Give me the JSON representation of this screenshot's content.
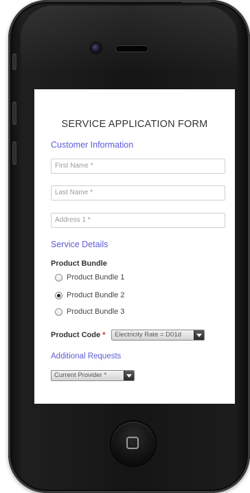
{
  "form": {
    "title": "SERVICE APPLICATION FORM",
    "sections": {
      "customer_information": "Customer Information",
      "service_details": "Service Details",
      "additional_requests": "Additional Requests"
    },
    "fields": {
      "first_name": "First Name *",
      "last_name": "Last Name *",
      "address1": "Address 1 *"
    },
    "product_bundle": {
      "label": "Product Bundle",
      "options": [
        "Product Bundle 1",
        "Product Bundle 2",
        "Product Bundle 3"
      ],
      "selected": "Product Bundle 2"
    },
    "product_code": {
      "label": "Product Code",
      "required_mark": "*",
      "value": "Electricity Rate = D01d"
    },
    "current_provider": {
      "value": "Current Provider *"
    }
  },
  "icons": {
    "home": "home-square-icon",
    "dropdown": "chevron-down-icon",
    "camera": "camera-icon",
    "speaker": "speaker-icon"
  }
}
